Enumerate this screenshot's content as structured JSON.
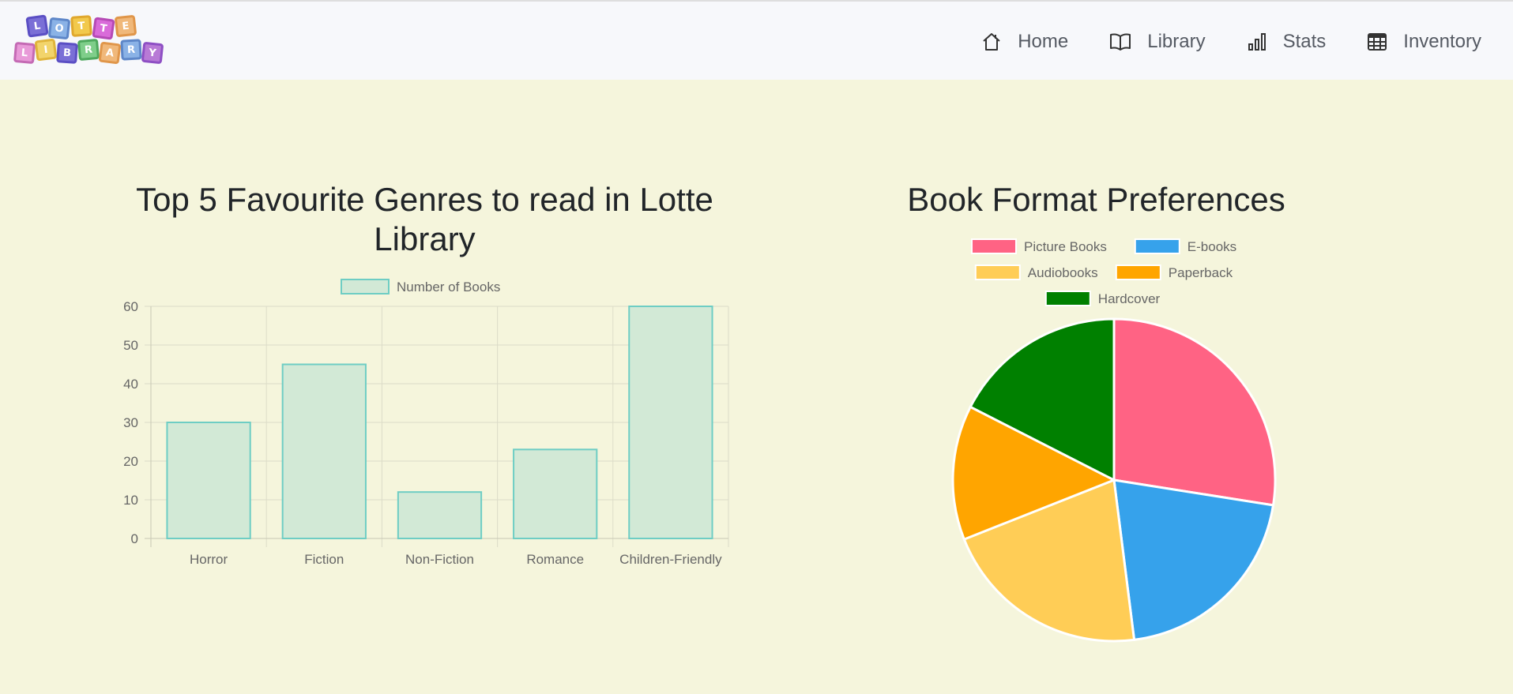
{
  "navbar": {
    "logo_letters": [
      "L",
      "O",
      "T",
      "T",
      "E",
      "L",
      "I",
      "B",
      "R",
      "A",
      "R",
      "Y"
    ],
    "items": [
      {
        "label": "Home",
        "icon": "home-icon"
      },
      {
        "label": "Library",
        "icon": "book-icon"
      },
      {
        "label": "Stats",
        "icon": "bar-chart-icon"
      },
      {
        "label": "Inventory",
        "icon": "table-icon"
      }
    ]
  },
  "colors": {
    "background": "#f5f5dc",
    "navbar": "#f7f8fb",
    "bar_fill": "#d2e9d6",
    "bar_border": "#6ecdc4"
  },
  "chart_data": [
    {
      "type": "bar",
      "title": "Top 5 Favourite Genres to read in Lotte Library",
      "categories": [
        "Horror",
        "Fiction",
        "Non-Fiction",
        "Romance",
        "Children-Friendly"
      ],
      "series": [
        {
          "name": "Number of Books",
          "values": [
            30,
            45,
            12,
            23,
            60
          ]
        }
      ],
      "yticks": [
        "0",
        "10",
        "20",
        "30",
        "40",
        "50",
        "60"
      ],
      "ylim": [
        0,
        60
      ],
      "grid": true,
      "legend": "top-center"
    },
    {
      "type": "pie",
      "title": "Book Format Preferences",
      "labels": [
        "Picture Books",
        "E-books",
        "Audiobooks",
        "Paperback",
        "Hardcover"
      ],
      "values": [
        27.5,
        20.5,
        21,
        13.5,
        17.5
      ],
      "colors": [
        "#ff6384",
        "#36a2eb",
        "#ffcd56",
        "#ffa500",
        "#008000"
      ],
      "legend": "top-center"
    }
  ]
}
